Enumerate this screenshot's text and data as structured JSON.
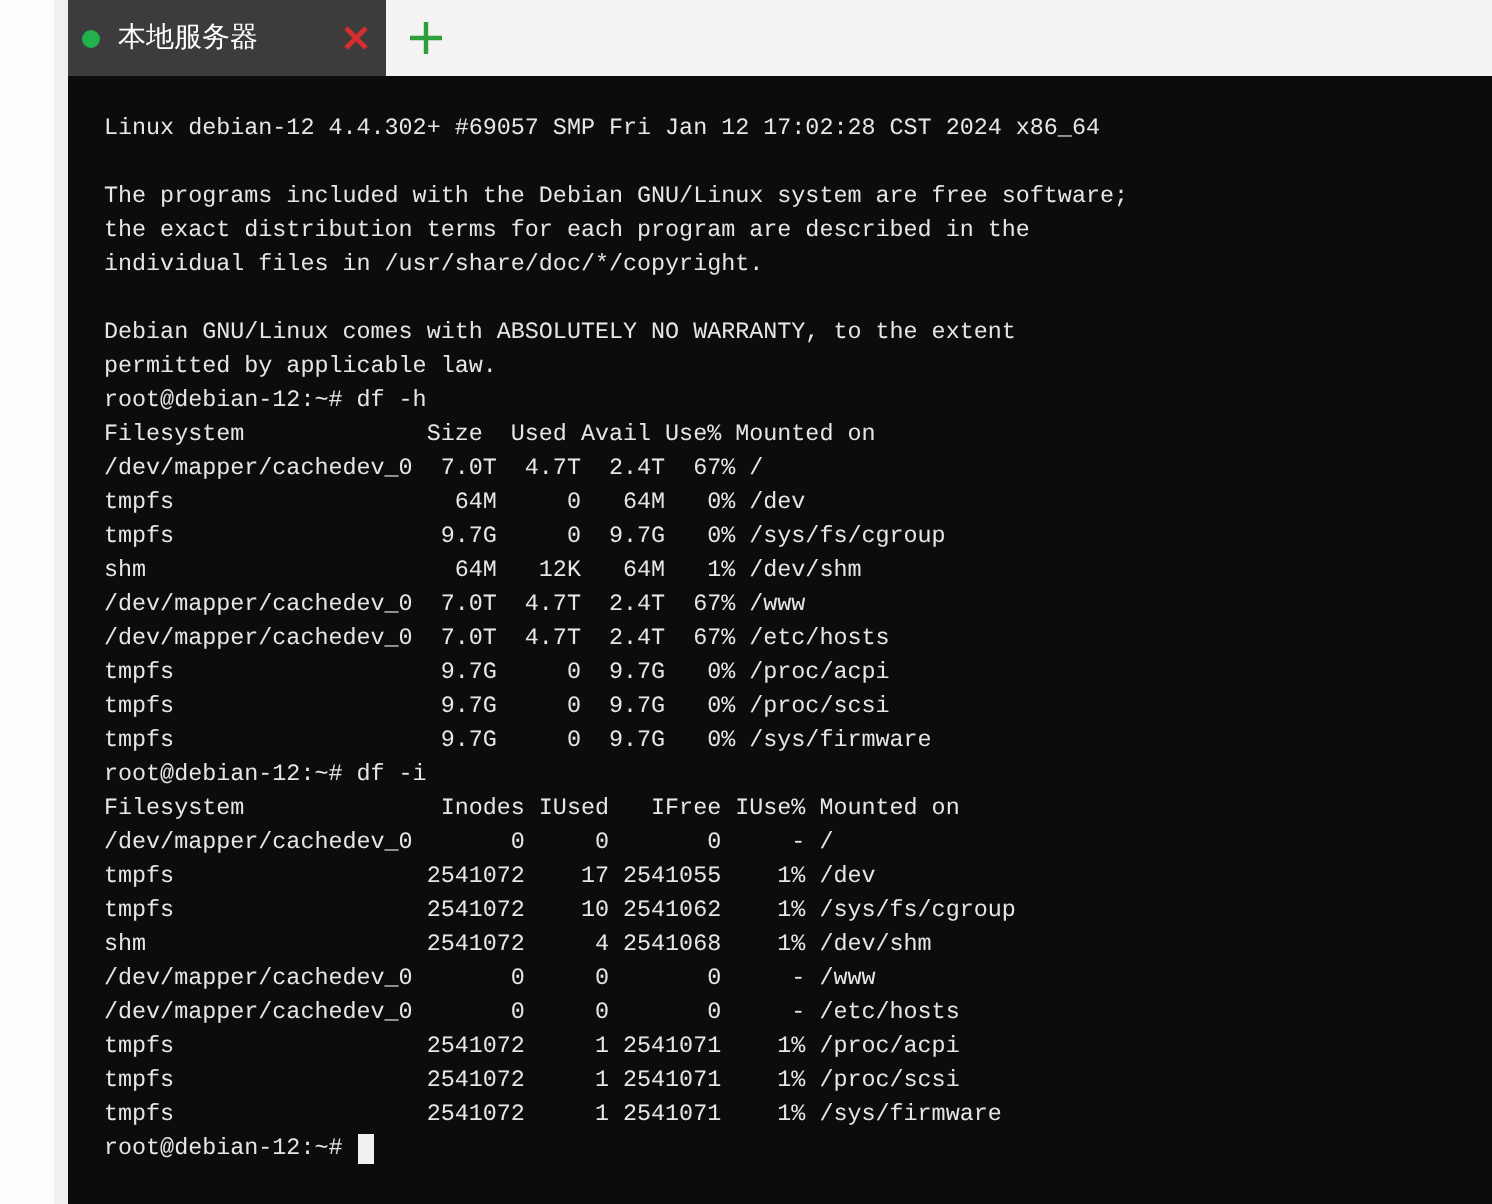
{
  "tabs": [
    {
      "label": "本地服务器",
      "selected": true,
      "connected": true
    }
  ],
  "terminal": {
    "blocks": [
      [
        "Linux debian-12 4.4.302+ #69057 SMP Fri Jan 12 17:02:28 CST 2024 x86_64"
      ],
      [
        "The programs included with the Debian GNU/Linux system are free software;",
        "the exact distribution terms for each program are described in the",
        "individual files in /usr/share/doc/*/copyright."
      ],
      [
        "Debian GNU/Linux comes with ABSOLUTELY NO WARRANTY, to the extent",
        "permitted by applicable law.",
        "root@debian-12:~# df -h",
        "Filesystem             Size  Used Avail Use% Mounted on",
        "/dev/mapper/cachedev_0  7.0T  4.7T  2.4T  67% /",
        "tmpfs                    64M     0   64M   0% /dev",
        "tmpfs                   9.7G     0  9.7G   0% /sys/fs/cgroup",
        "shm                      64M   12K   64M   1% /dev/shm",
        "/dev/mapper/cachedev_0  7.0T  4.7T  2.4T  67% /www",
        "/dev/mapper/cachedev_0  7.0T  4.7T  2.4T  67% /etc/hosts",
        "tmpfs                   9.7G     0  9.7G   0% /proc/acpi",
        "tmpfs                   9.7G     0  9.7G   0% /proc/scsi",
        "tmpfs                   9.7G     0  9.7G   0% /sys/firmware",
        "root@debian-12:~# df -i",
        "Filesystem              Inodes IUsed   IFree IUse% Mounted on",
        "/dev/mapper/cachedev_0       0     0       0     - /",
        "tmpfs                  2541072    17 2541055    1% /dev",
        "tmpfs                  2541072    10 2541062    1% /sys/fs/cgroup",
        "shm                    2541072     4 2541068    1% /dev/shm",
        "/dev/mapper/cachedev_0       0     0       0     - /www",
        "/dev/mapper/cachedev_0       0     0       0     - /etc/hosts",
        "tmpfs                  2541072     1 2541071    1% /proc/acpi",
        "tmpfs                  2541072     1 2541071    1% /proc/scsi",
        "tmpfs                  2541072     1 2541071    1% /sys/firmware"
      ]
    ],
    "prompt": "root@debian-12:~#"
  }
}
